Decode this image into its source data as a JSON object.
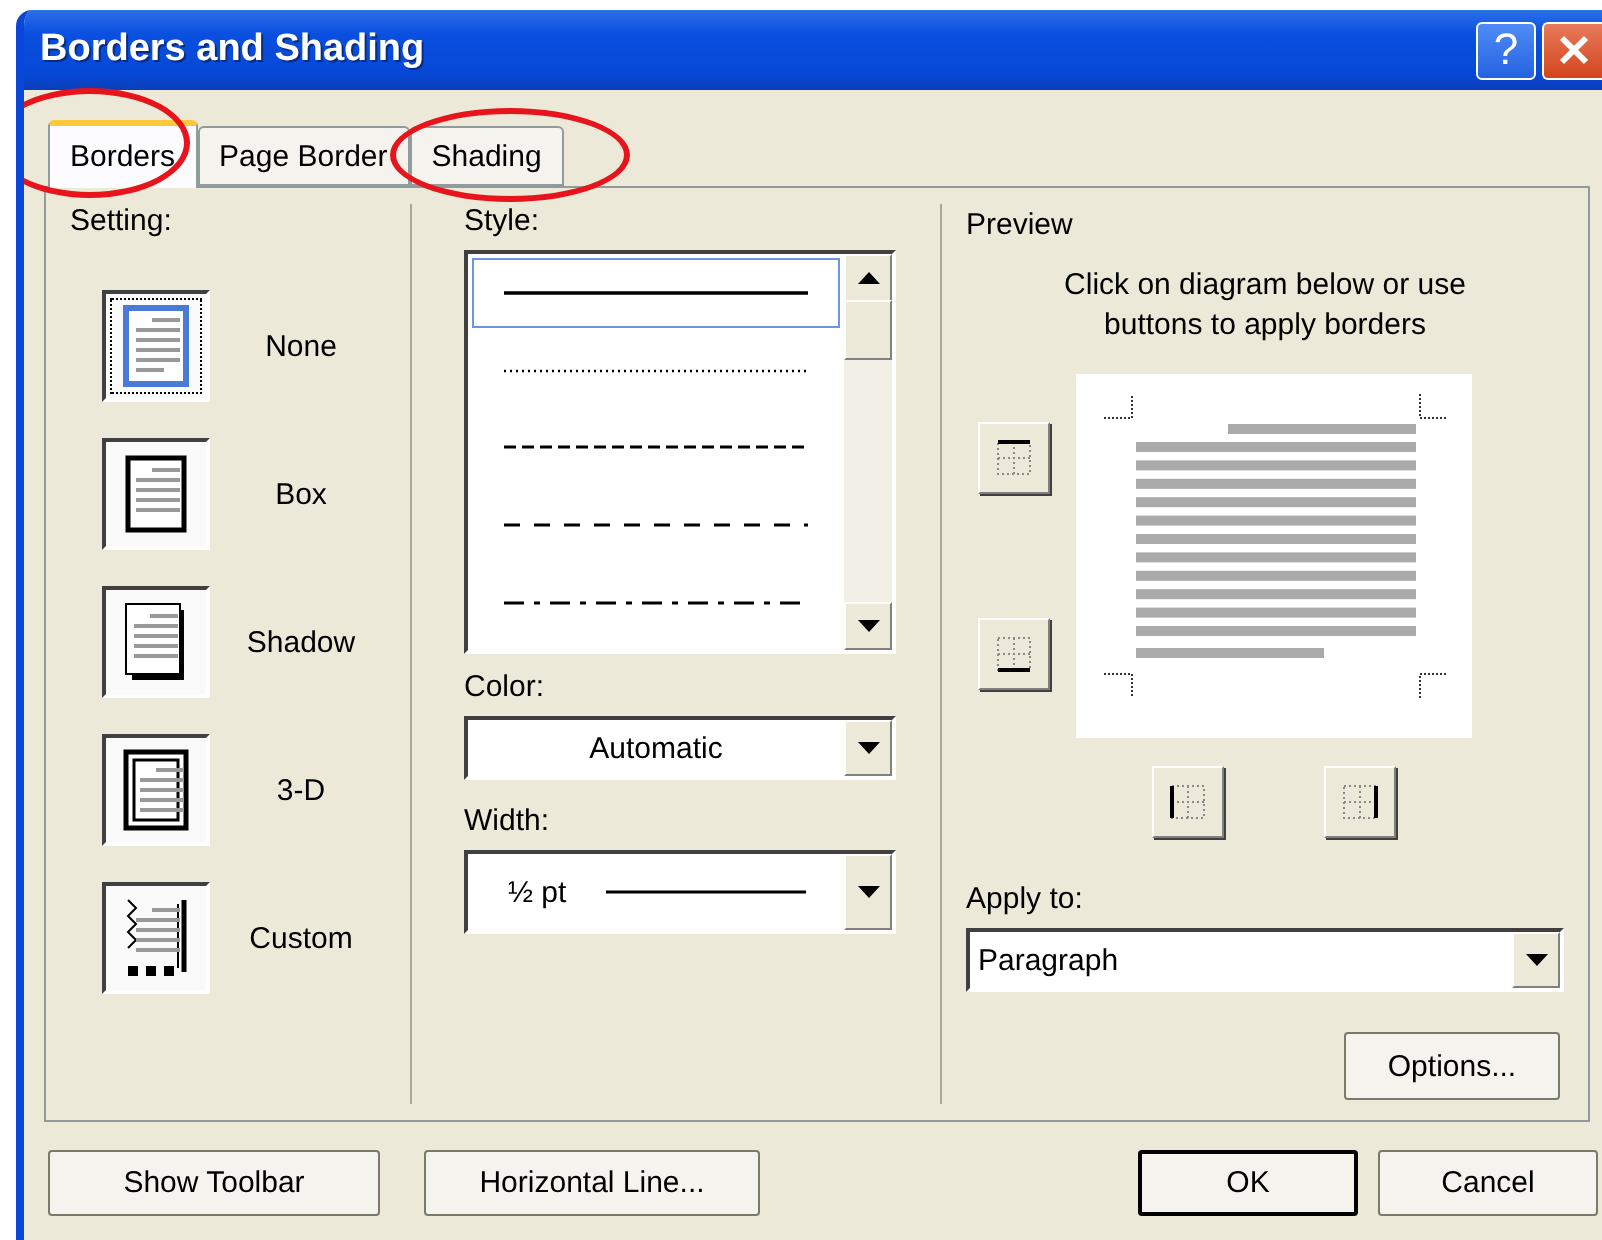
{
  "window": {
    "title": "Borders and Shading",
    "help_label": "?"
  },
  "tabs": [
    {
      "label": "Borders",
      "selected": true,
      "circled": true
    },
    {
      "label": "Page Border",
      "selected": false,
      "circled": false
    },
    {
      "label": "Shading",
      "selected": false,
      "circled": true
    }
  ],
  "setting": {
    "label": "Setting:",
    "options": [
      {
        "kind": "none",
        "label": "None",
        "selected": true
      },
      {
        "kind": "box",
        "label": "Box",
        "selected": false
      },
      {
        "kind": "shadow",
        "label": "Shadow",
        "selected": false
      },
      {
        "kind": "threed",
        "label": "3-D",
        "selected": false
      },
      {
        "kind": "custom",
        "label": "Custom",
        "selected": false
      }
    ]
  },
  "style": {
    "label": "Style:",
    "items": [
      {
        "kind": "solid",
        "selected": true
      },
      {
        "kind": "dotted",
        "selected": false
      },
      {
        "kind": "dashed",
        "selected": false
      },
      {
        "kind": "spaced",
        "selected": false
      },
      {
        "kind": "dashdot",
        "selected": false
      }
    ]
  },
  "color": {
    "label": "Color:",
    "value": "Automatic"
  },
  "width": {
    "label": "Width:",
    "value": "½ pt"
  },
  "preview": {
    "label": "Preview",
    "instructions": "Click on diagram below or use buttons to apply borders"
  },
  "apply_to": {
    "label": "Apply to:",
    "value": "Paragraph"
  },
  "options_button": "Options...",
  "footer": {
    "left": [
      "Show Toolbar",
      "Horizontal Line..."
    ],
    "right": [
      {
        "kind": "default",
        "label": "OK"
      },
      {
        "kind": "normal",
        "label": "Cancel"
      }
    ]
  }
}
